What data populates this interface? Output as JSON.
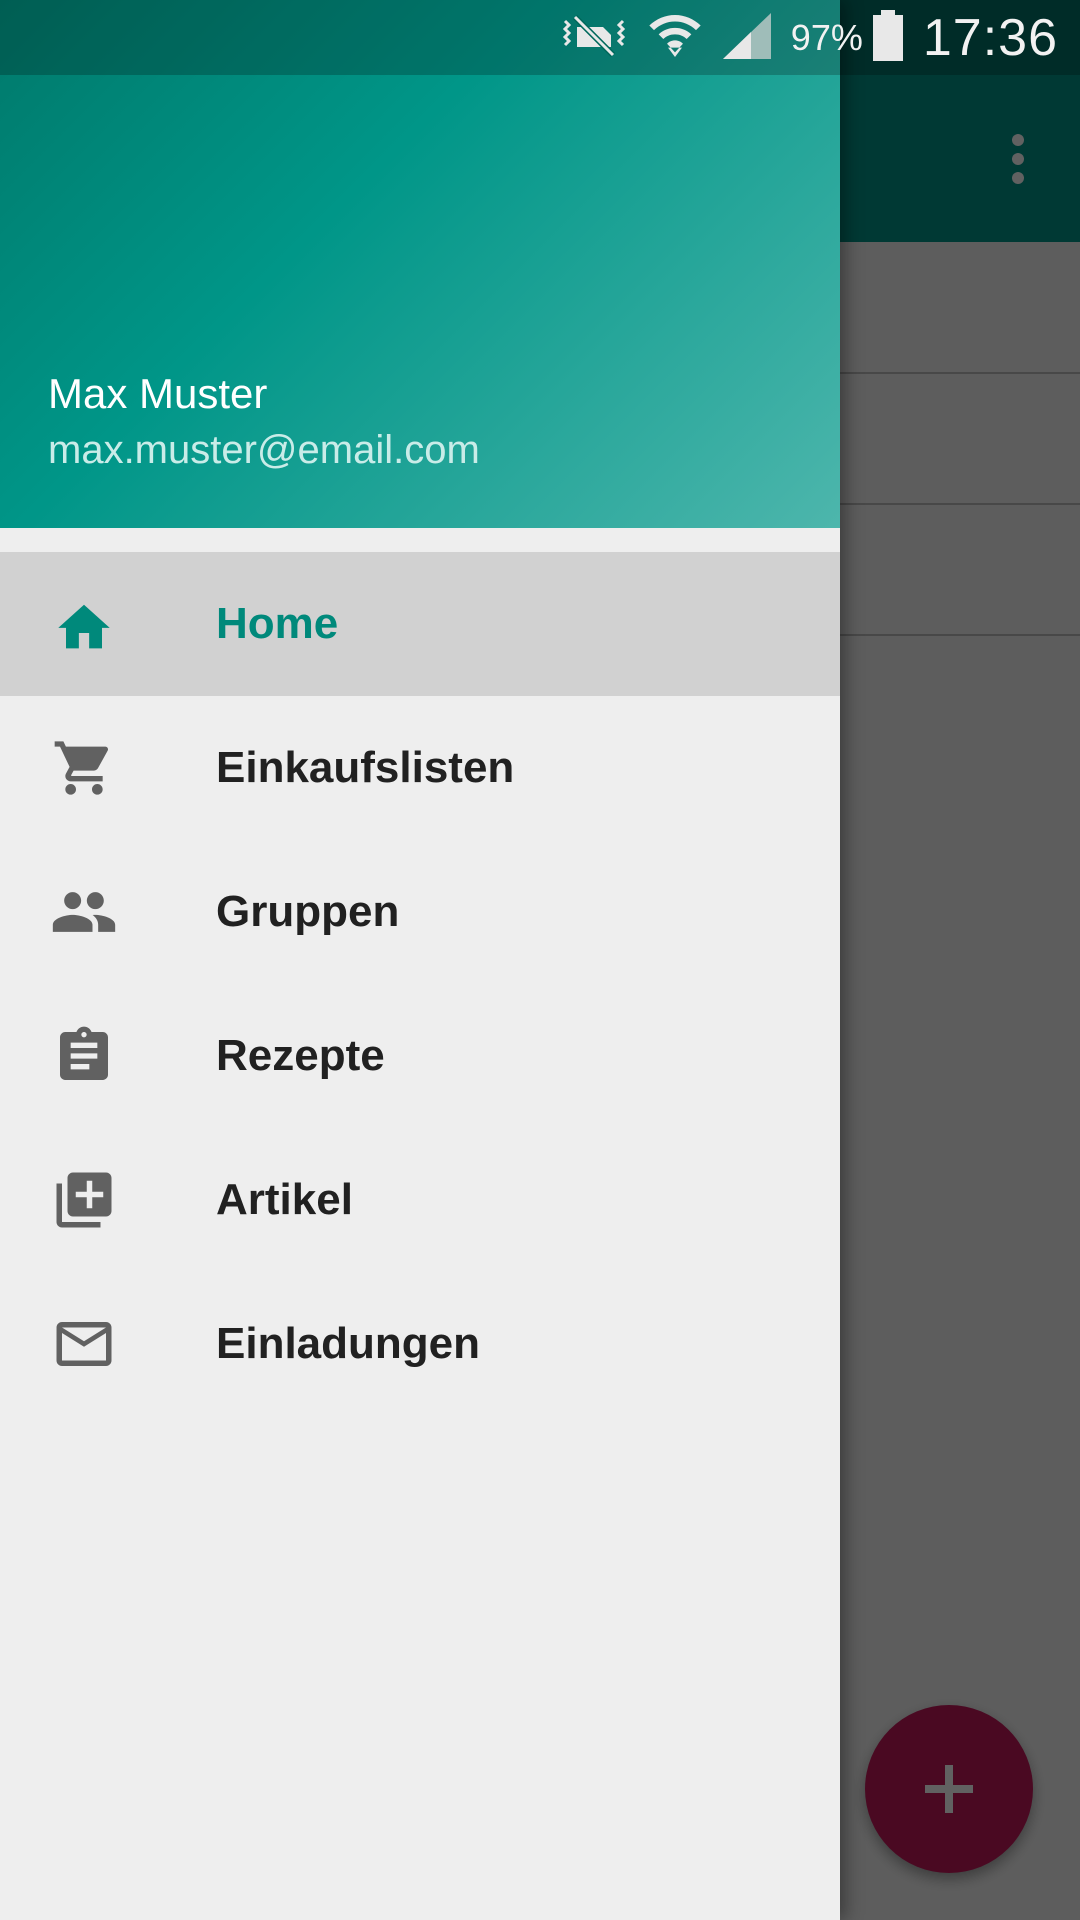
{
  "status_bar": {
    "battery": "97%",
    "time": "17:36"
  },
  "drawer": {
    "user_name": "Max Muster",
    "user_email": "max.muster@email.com",
    "items": [
      {
        "label": "Home",
        "icon": "home-icon",
        "active": true
      },
      {
        "label": "Einkaufslisten",
        "icon": "cart-icon",
        "active": false
      },
      {
        "label": "Gruppen",
        "icon": "group-icon",
        "active": false
      },
      {
        "label": "Rezepte",
        "icon": "clipboard-icon",
        "active": false
      },
      {
        "label": "Artikel",
        "icon": "library-add-icon",
        "active": false
      },
      {
        "label": "Einladungen",
        "icon": "mail-icon",
        "active": false
      }
    ]
  },
  "colors": {
    "primary": "#009688",
    "accent": "#c2185b",
    "active_text": "#00897b"
  }
}
